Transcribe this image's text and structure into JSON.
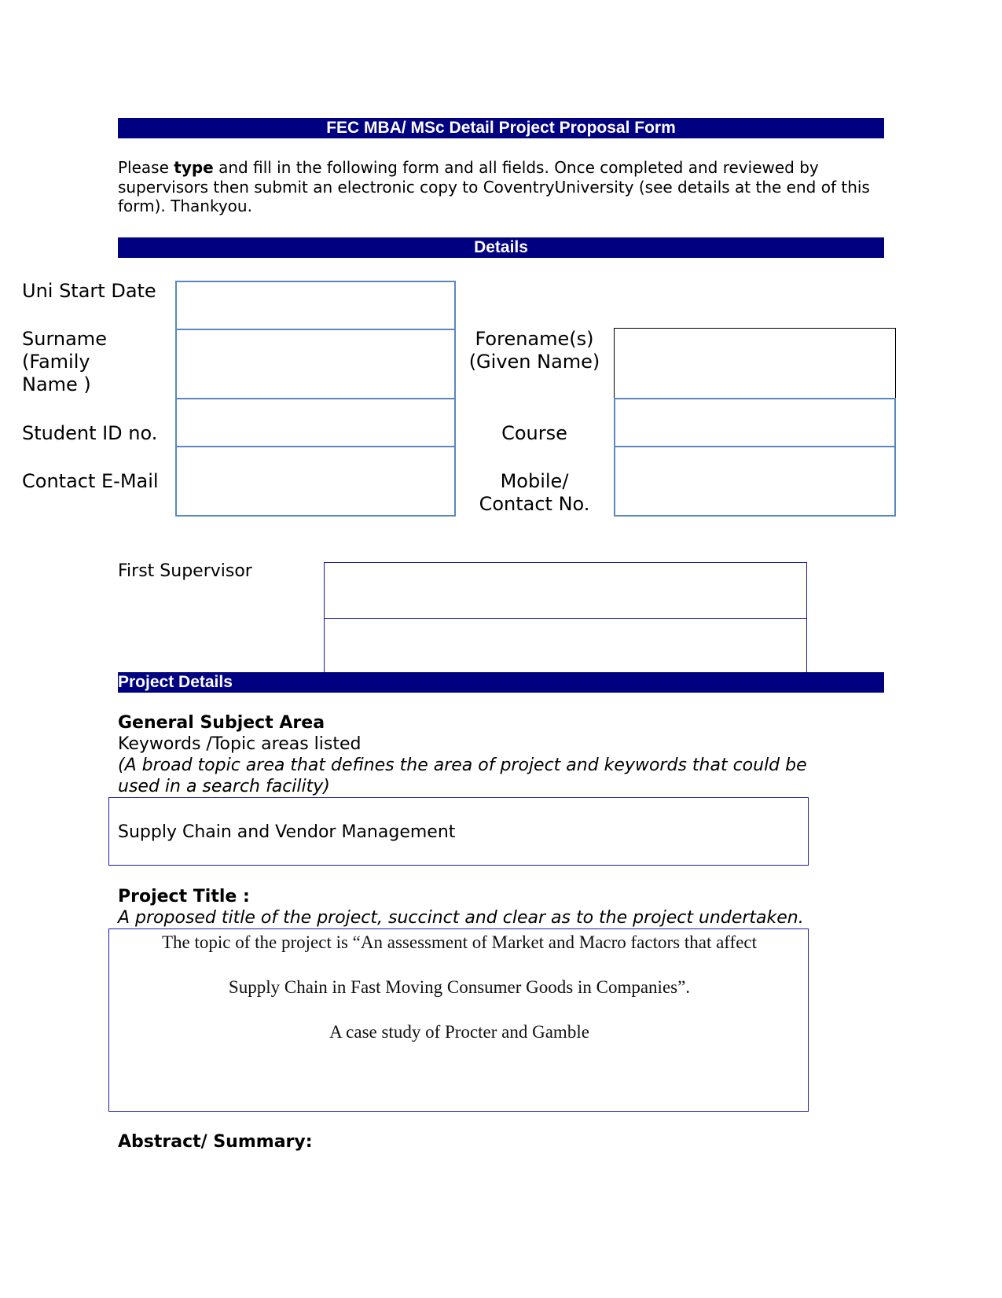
{
  "form": {
    "title": "FEC MBA/ MSc Detail Project Proposal Form",
    "intro": {
      "part1": "Please ",
      "bold": "type",
      "part2": " and fill in the following form and all fields.  Once completed and reviewed by supervisors then submit an electronic copy  to CoventryUniversity (see details at the end of this form).   Thankyou."
    }
  },
  "details": {
    "header": "Details",
    "fields": {
      "uni_start_date": {
        "label": "Uni Start Date",
        "value": ""
      },
      "surname": {
        "label_lines": [
          "Surname",
          "(Family",
          "Name )"
        ],
        "value": ""
      },
      "forename": {
        "label_lines": [
          "Forename(s)",
          "(Given Name)"
        ],
        "value": ""
      },
      "student_id": {
        "label": "Student ID no.",
        "value": ""
      },
      "course": {
        "label": "Course",
        "value": ""
      },
      "email": {
        "label": "Contact E-Mail",
        "value": ""
      },
      "mobile": {
        "label_lines": [
          "Mobile/",
          "Contact No."
        ],
        "value": ""
      }
    },
    "supervisor": {
      "label": "First Supervisor",
      "value_line1": "",
      "value_line2": ""
    }
  },
  "project": {
    "header": "Project Details",
    "subject_area": {
      "heading": "General Subject Area",
      "subheading": "Keywords /Topic areas listed",
      "hint": "(A broad topic area that defines the area of project and keywords that could be used in a search facility)",
      "value": "Supply Chain and Vendor Management"
    },
    "title": {
      "heading": "Project Title :",
      "hint": "A proposed title of the project, succinct and clear as to the project undertaken.",
      "lines": [
        "The topic of the project is “An assessment of Market and Macro factors that affect",
        "Supply Chain in Fast Moving Consumer Goods in Companies”.",
        "A case study of Procter and Gamble"
      ]
    },
    "abstract": {
      "heading": "Abstract/ Summary:"
    }
  },
  "colors": {
    "header_bar": "#000080",
    "field_border": "#5b87c0",
    "box_border_navy": "#1a1aa6"
  }
}
